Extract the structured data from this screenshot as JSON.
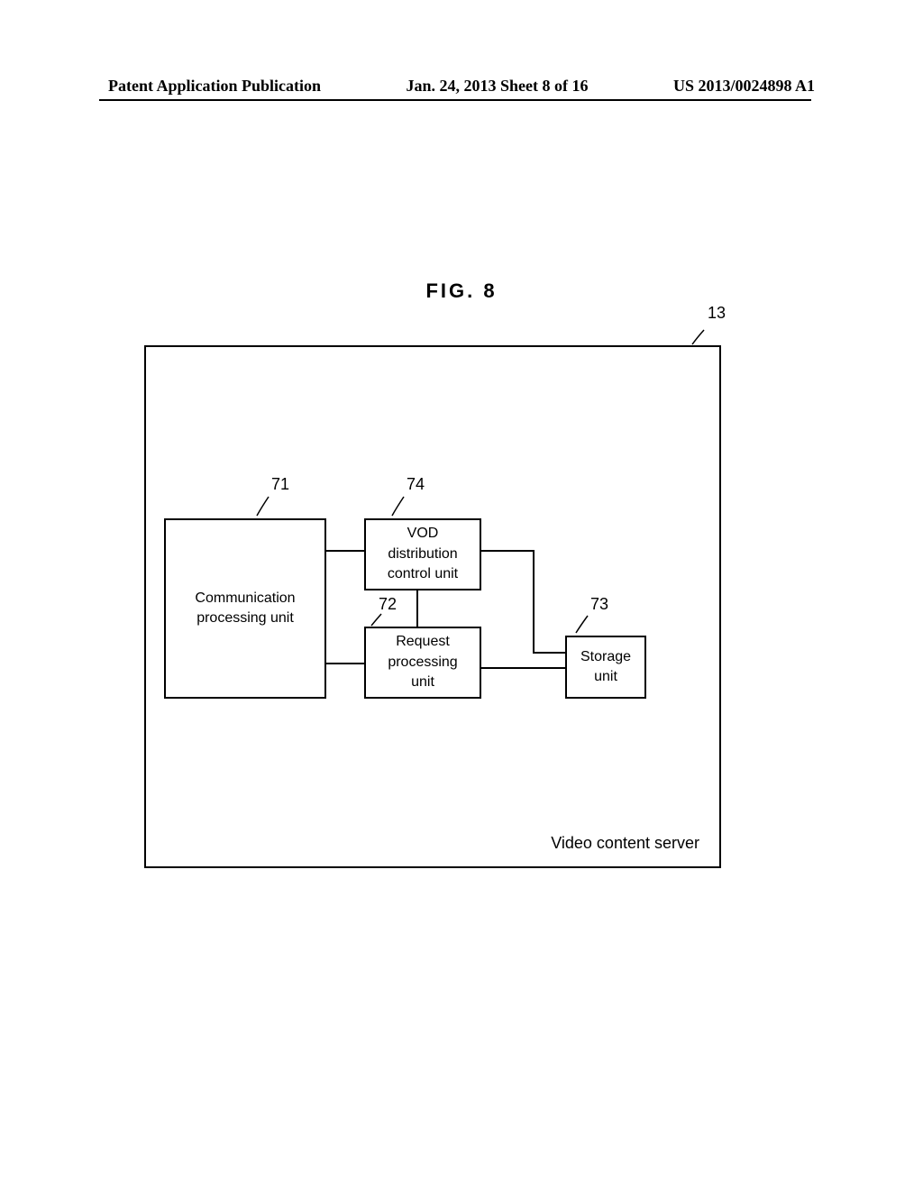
{
  "header": {
    "left": "Patent Application Publication",
    "center": "Jan. 24, 2013  Sheet 8 of 16",
    "right": "US 2013/0024898 A1"
  },
  "figure": {
    "label": "FIG. 8",
    "outer_ref": "13",
    "outer_label": "Video content server",
    "boxes": {
      "71": {
        "ref": "71",
        "label_line1": "Communication",
        "label_line2": "processing unit"
      },
      "74": {
        "ref": "74",
        "label_line1": "VOD",
        "label_line2": "distribution",
        "label_line3": "control unit"
      },
      "72": {
        "ref": "72",
        "label_line1": "Request",
        "label_line2": "processing",
        "label_line3": "unit"
      },
      "73": {
        "ref": "73",
        "label_line1": "Storage",
        "label_line2": "unit"
      }
    }
  }
}
